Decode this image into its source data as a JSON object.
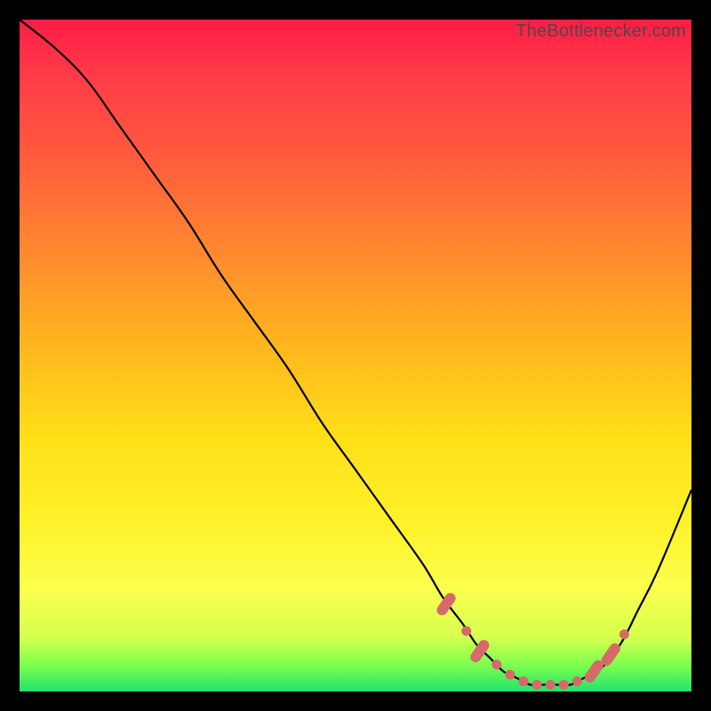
{
  "watermark": "TheBottlenecker.com",
  "colors": {
    "frame": "#000000",
    "curve": "#000000",
    "marker": "#d66a6a",
    "gradient_top": "#ff1c46",
    "gradient_bottom": "#22e36b"
  },
  "chart_data": {
    "type": "line",
    "title": "",
    "xlabel": "",
    "ylabel": "",
    "xlim": [
      0,
      100
    ],
    "ylim": [
      0,
      100
    ],
    "series": [
      {
        "name": "bottleneck-curve",
        "x": [
          0,
          5,
          10,
          15,
          20,
          25,
          30,
          35,
          40,
          45,
          50,
          55,
          60,
          63,
          66,
          68,
          70,
          72,
          74,
          76,
          78,
          80,
          82,
          84,
          86,
          88,
          90,
          92,
          95,
          100
        ],
        "y": [
          100,
          96,
          91,
          84,
          77,
          70,
          62,
          55,
          48,
          40,
          33,
          26,
          19,
          14,
          10,
          7,
          5,
          3,
          2,
          1,
          1,
          1,
          1,
          2,
          3,
          5,
          8,
          12,
          18,
          30
        ]
      }
    ],
    "markers": {
      "name": "optimal-range",
      "points": [
        {
          "x": 63.5,
          "y": 13,
          "shape": "pill"
        },
        {
          "x": 66.5,
          "y": 9,
          "shape": "dot"
        },
        {
          "x": 68.5,
          "y": 6,
          "shape": "pill"
        },
        {
          "x": 71,
          "y": 4,
          "shape": "dot"
        },
        {
          "x": 73,
          "y": 2.5,
          "shape": "dot"
        },
        {
          "x": 75,
          "y": 1.5,
          "shape": "dot"
        },
        {
          "x": 77,
          "y": 1,
          "shape": "dot"
        },
        {
          "x": 79,
          "y": 1,
          "shape": "dot"
        },
        {
          "x": 81,
          "y": 1,
          "shape": "dot"
        },
        {
          "x": 83,
          "y": 1.5,
          "shape": "dot"
        },
        {
          "x": 85.5,
          "y": 3,
          "shape": "pill"
        },
        {
          "x": 88,
          "y": 5.5,
          "shape": "pill"
        },
        {
          "x": 90,
          "y": 8.5,
          "shape": "dot"
        }
      ]
    }
  }
}
